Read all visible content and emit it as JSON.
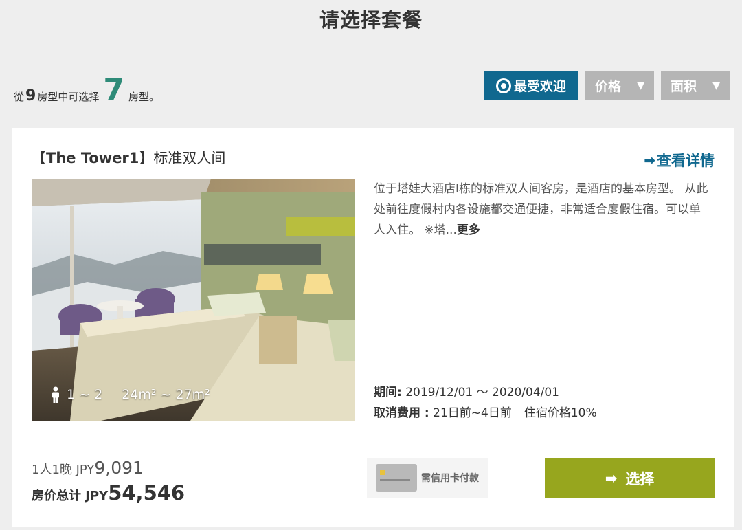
{
  "page": {
    "title": "请选择套餐"
  },
  "summary": {
    "prefix": "從",
    "total_count": "9",
    "middle": "房型中可选择",
    "available_count": "7",
    "suffix": "房型。"
  },
  "sort": {
    "popular_label": "最受欢迎",
    "price_label": "价格",
    "area_label": "面积",
    "dropdown_glyph": "▼"
  },
  "room": {
    "name_prefix": "【",
    "name_bold": "The Tower1",
    "name_suffix": "】标准双人间",
    "detail_link": "查看详情",
    "description": "位于塔娃大酒店Ⅰ栋的标准双人间客房，是酒店的基本房型。 从此处前往度假村内各设施都交通便捷，非常适合度假住宿。可以单人入住。 ※塔...",
    "more_label": "更多",
    "capacity": "1 ~ 2",
    "area": "24m² ~ 27m²",
    "period_label": "期间:",
    "period_value": " 2019/12/01 ～ 2020/04/01",
    "cancel_label": "取消费用 :",
    "cancel_days": " 21日前~4日前",
    "cancel_rate": "住宿价格10%"
  },
  "price": {
    "per_night_label": "1人1晚 JPY",
    "per_night_value": "9,091",
    "total_label": "房价总计 JPY",
    "total_value": "54,546"
  },
  "payment": {
    "badge_text": "需信用卡付款"
  },
  "actions": {
    "select_label": "选择"
  },
  "colors": {
    "accent_blue": "#10688f",
    "green_count": "#2e8b78",
    "select_green": "#97a61e",
    "inactive_gray": "#b5b5b5",
    "background": "#eeeeee"
  }
}
